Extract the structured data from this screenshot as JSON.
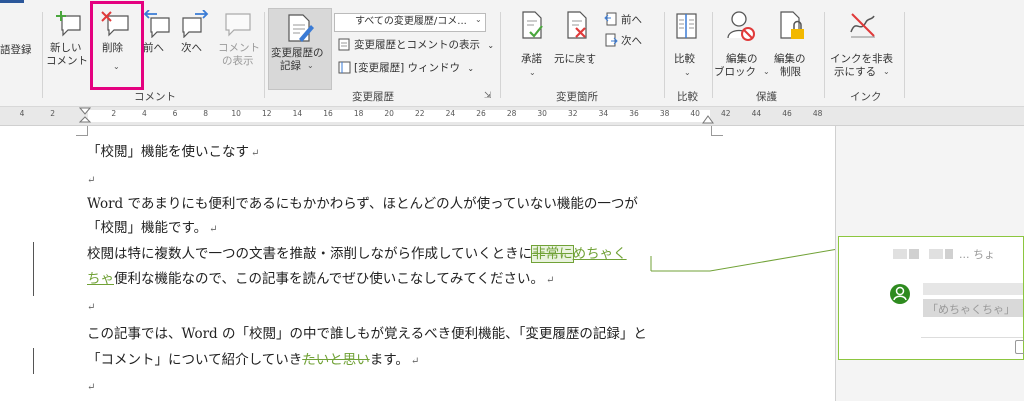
{
  "ribbon": {
    "left_cut_label": "語登録",
    "comment_group": {
      "label": "コメント",
      "new_comment_line1": "新しい",
      "new_comment_line2": "コメント",
      "delete": "削除",
      "prev": "前へ",
      "next": "次へ",
      "show_comments_line1": "コメント",
      "show_comments_line2": "の表示"
    },
    "tracking_group": {
      "label": "変更履歴",
      "track_changes_line1": "変更履歴の",
      "track_changes_line2": "記録",
      "markup_dropdown": "すべての変更履歴/コメ...",
      "show_markup": "変更履歴とコメントの表示",
      "reviewing_pane": "[変更履歴] ウィンドウ"
    },
    "changes_group": {
      "label": "変更箇所",
      "accept": "承諾",
      "reject": "元に戻す",
      "prev": "前へ",
      "next": "次へ"
    },
    "compare_group": {
      "label": "比較",
      "compare": "比較"
    },
    "protect_group": {
      "label": "保護",
      "block_line1": "編集の",
      "block_line2": "ブロック",
      "restrict_line1": "編集の",
      "restrict_line2": "制限"
    },
    "ink_group": {
      "label": "インク",
      "hide_ink_line1": "インクを非表",
      "hide_ink_line2": "示にする"
    }
  },
  "ruler": {
    "ticks": [
      "4",
      "2",
      "",
      "2",
      "4",
      "6",
      "8",
      "10",
      "12",
      "14",
      "16",
      "18",
      "20",
      "22",
      "24",
      "26",
      "28",
      "30",
      "32",
      "34",
      "36",
      "38",
      "40",
      "42",
      "44",
      "46",
      "48"
    ]
  },
  "document": {
    "line1": "「校閲」機能を使いこなす",
    "line3": "Word であまりにも便利であるにもかかわらず、ほとんどの人が使っていない機能の一つが",
    "line4": "「校閲」機能です。",
    "line5_pre": "校閲は特に複数人で一つの文書を推敲・添削しながら作成していくときに",
    "line5_del": "非常に",
    "line5_ins": "めちゃく",
    "line6_ins": "ちゃ",
    "line6_post": "便利な機能なので、この記事を読んでぜひ使いこなしてみてください。",
    "line8": "この記事では、Word の「校閲」の中で誰しもが覚えるべき便利機能、「変更履歴の記録」と",
    "line9_pre": "「コメント」について紹介していき",
    "line9_del": "たいと思い",
    "line9_post": "ます。",
    "para_mark": "↵"
  },
  "comment": {
    "header_suffix": "... ちょ",
    "quoted_text": "「めちゃくちゃ」"
  },
  "colors": {
    "highlight": "#e4007f",
    "revision": "#71a237",
    "avatar": "#2e8b1f"
  }
}
